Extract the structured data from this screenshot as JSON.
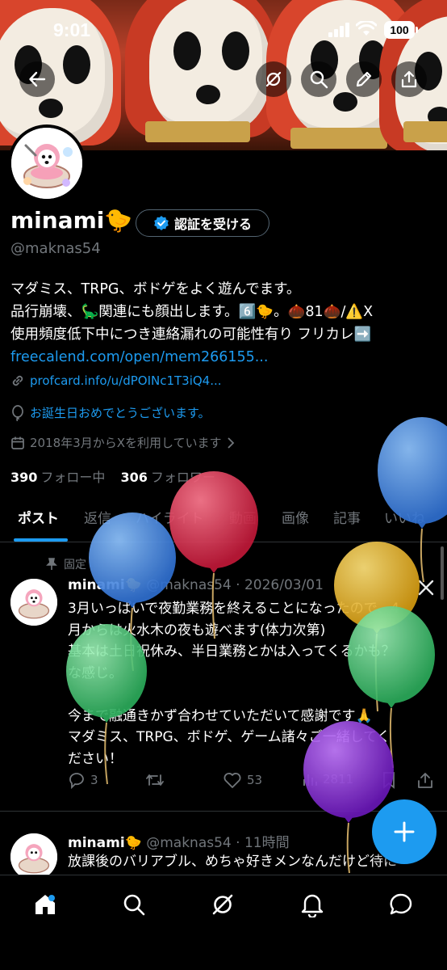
{
  "status_bar": {
    "time": "9:01",
    "battery": "100"
  },
  "header": {
    "back_icon": "arrow-left-icon",
    "grok_icon": "grok-icon",
    "search_icon": "search-icon",
    "edit_icon": "pencil-icon",
    "share_icon": "share-icon"
  },
  "profile": {
    "name": "minami",
    "name_emoji": "🐤",
    "verify_button": "認証を受ける",
    "handle": "@maknas54",
    "bio_lines": [
      "マダミス、TRPG、ボドゲをよく遊んでます。",
      "品行崩壊、🦕関連にも顔出します。6️⃣🐤。🌰81🌰/⚠️X",
      "使用頻度低下中につき連絡漏れの可能性有り フリカレ➡️"
    ],
    "bio_link": "freecalend.com/open/mem266155...",
    "website": "profcard.info/u/dPOINc1T3iQ4...",
    "birthday": "お誕生日おめでとうございます。",
    "joined": "2018年3月からXを利用しています",
    "following_count": "390",
    "following_label": "フォロー中",
    "followers_count": "306",
    "followers_label": "フォロワー"
  },
  "tabs": [
    "ポスト",
    "返信",
    "ハイライト",
    "動画",
    "画像",
    "記事",
    "いいね"
  ],
  "posts": [
    {
      "pinned_label": "固定",
      "name": "minami🐤",
      "meta": "@maknas54 · 2026/03/01",
      "body_lines": [
        "3月いっぱいで夜勤業務を終えることになったので、4",
        "月からは火水木の夜も遊べます(体力次第)",
        "基本は土日祝休み、半日業務とかは入ってくるかも？",
        "な感じ。",
        "",
        "今まで融通きかず合わせていただいて感謝です🙏",
        "マダミス、TRPG、ボドゲ、ゲーム諸々ご一緒してく",
        "ださい！"
      ],
      "replies": "3",
      "likes": "53",
      "views": "2811"
    },
    {
      "name": "minami🐤",
      "meta": "@maknas54 · 11時間",
      "body_lines": [
        "放課後のバリアブル、めちゃ好きメンなんだけど待に"
      ]
    }
  ],
  "fab_label": "+",
  "bottom_nav": [
    "home-icon",
    "search-icon",
    "grok-icon",
    "bell-icon",
    "message-icon"
  ],
  "colors": {
    "accent": "#1d9bf0",
    "background": "#000000",
    "text_secondary": "#71767b"
  }
}
